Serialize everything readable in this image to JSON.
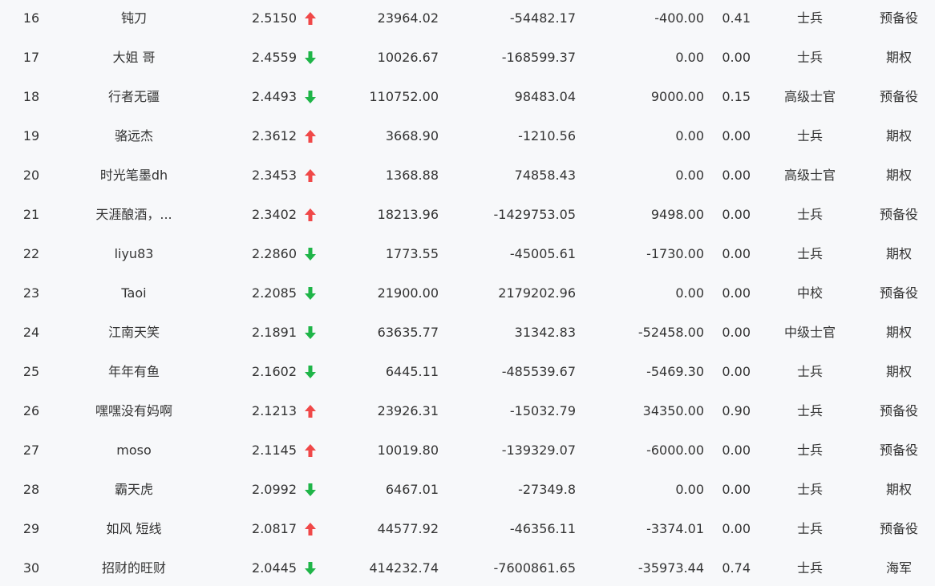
{
  "colors": {
    "up": "#f04848",
    "down": "#1fb548",
    "background": "#f7f8fa",
    "text": "#333333"
  },
  "rows": [
    {
      "rank": "16",
      "name": "钝刀",
      "score": "2.5150",
      "trend": "up",
      "v1": "23964.02",
      "v2": "-54482.17",
      "v3": "-400.00",
      "v4": "0.41",
      "level": "士兵",
      "category": "预备役"
    },
    {
      "rank": "17",
      "name": "大姐 哥",
      "score": "2.4559",
      "trend": "down",
      "v1": "10026.67",
      "v2": "-168599.37",
      "v3": "0.00",
      "v4": "0.00",
      "level": "士兵",
      "category": "期权"
    },
    {
      "rank": "18",
      "name": "行者无疆",
      "score": "2.4493",
      "trend": "down",
      "v1": "110752.00",
      "v2": "98483.04",
      "v3": "9000.00",
      "v4": "0.15",
      "level": "高级士官",
      "category": "预备役"
    },
    {
      "rank": "19",
      "name": "骆远杰",
      "score": "2.3612",
      "trend": "up",
      "v1": "3668.90",
      "v2": "-1210.56",
      "v3": "0.00",
      "v4": "0.00",
      "level": "士兵",
      "category": "期权"
    },
    {
      "rank": "20",
      "name": "时光笔墨dh",
      "score": "2.3453",
      "trend": "up",
      "v1": "1368.88",
      "v2": "74858.43",
      "v3": "0.00",
      "v4": "0.00",
      "level": "高级士官",
      "category": "期权"
    },
    {
      "rank": "21",
      "name": "天涯酿酒，...",
      "score": "2.3402",
      "trend": "up",
      "v1": "18213.96",
      "v2": "-1429753.05",
      "v3": "9498.00",
      "v4": "0.00",
      "level": "士兵",
      "category": "预备役"
    },
    {
      "rank": "22",
      "name": "liyu83",
      "score": "2.2860",
      "trend": "down",
      "v1": "1773.55",
      "v2": "-45005.61",
      "v3": "-1730.00",
      "v4": "0.00",
      "level": "士兵",
      "category": "期权"
    },
    {
      "rank": "23",
      "name": "Taoi",
      "score": "2.2085",
      "trend": "down",
      "v1": "21900.00",
      "v2": "2179202.96",
      "v3": "0.00",
      "v4": "0.00",
      "level": "中校",
      "category": "预备役"
    },
    {
      "rank": "24",
      "name": "江南天笑",
      "score": "2.1891",
      "trend": "down",
      "v1": "63635.77",
      "v2": "31342.83",
      "v3": "-52458.00",
      "v4": "0.00",
      "level": "中级士官",
      "category": "期权"
    },
    {
      "rank": "25",
      "name": "年年有鱼",
      "score": "2.1602",
      "trend": "down",
      "v1": "6445.11",
      "v2": "-485539.67",
      "v3": "-5469.30",
      "v4": "0.00",
      "level": "士兵",
      "category": "期权"
    },
    {
      "rank": "26",
      "name": "嘿嘿没有妈啊",
      "score": "2.1213",
      "trend": "up",
      "v1": "23926.31",
      "v2": "-15032.79",
      "v3": "34350.00",
      "v4": "0.90",
      "level": "士兵",
      "category": "预备役"
    },
    {
      "rank": "27",
      "name": "moso",
      "score": "2.1145",
      "trend": "up",
      "v1": "10019.80",
      "v2": "-139329.07",
      "v3": "-6000.00",
      "v4": "0.00",
      "level": "士兵",
      "category": "预备役"
    },
    {
      "rank": "28",
      "name": "霸天虎",
      "score": "2.0992",
      "trend": "down",
      "v1": "6467.01",
      "v2": "-27349.8",
      "v3": "0.00",
      "v4": "0.00",
      "level": "士兵",
      "category": "期权"
    },
    {
      "rank": "29",
      "name": "如风 短线",
      "score": "2.0817",
      "trend": "up",
      "v1": "44577.92",
      "v2": "-46356.11",
      "v3": "-3374.01",
      "v4": "0.00",
      "level": "士兵",
      "category": "预备役"
    },
    {
      "rank": "30",
      "name": "招财的旺财",
      "score": "2.0445",
      "trend": "down",
      "v1": "414232.74",
      "v2": "-7600861.65",
      "v3": "-35973.44",
      "v4": "0.74",
      "level": "士兵",
      "category": "海军"
    }
  ]
}
